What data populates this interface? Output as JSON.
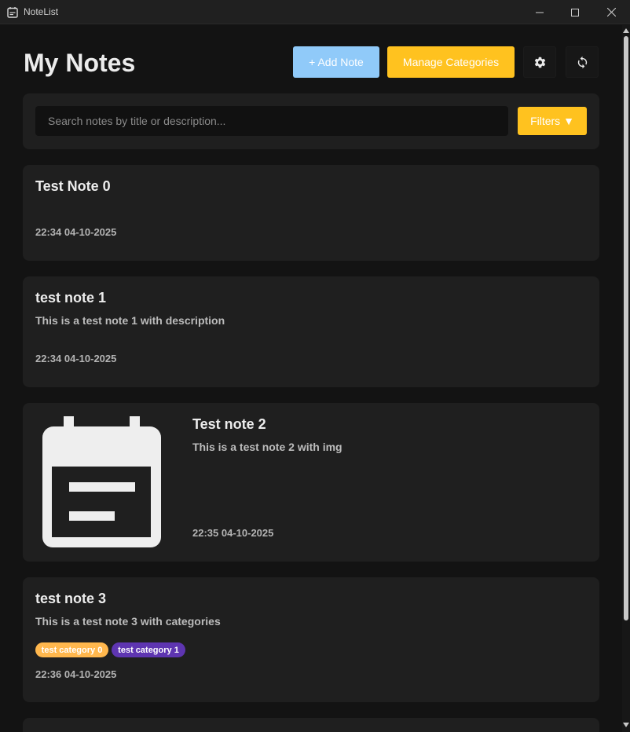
{
  "window": {
    "title": "NoteList"
  },
  "header": {
    "title": "My Notes",
    "add_note_label": "+ Add Note",
    "manage_categories_label": "Manage Categories",
    "settings_icon": "gear-icon",
    "refresh_icon": "refresh-icon"
  },
  "search": {
    "placeholder": "Search notes by title or description...",
    "filters_label": "Filters ▼"
  },
  "notes": [
    {
      "title": "Test Note 0",
      "description": "",
      "timestamp": "22:34 04-10-2025"
    },
    {
      "title": "test note 1",
      "description": "This is a test note 1 with description",
      "timestamp": "22:34 04-10-2025"
    },
    {
      "title": "Test note 2",
      "description": "This is a test note 2 with img",
      "timestamp": "22:35 04-10-2025",
      "image_icon": "calendar-note-icon"
    },
    {
      "title": "test note 3",
      "description": "This is a test note 3 with categories",
      "timestamp": "22:36 04-10-2025",
      "categories": [
        {
          "name": "test category 0",
          "color": "#ffb74d"
        },
        {
          "name": "test category 1",
          "color": "#5e35b1"
        }
      ]
    }
  ],
  "colors": {
    "accent_yellow": "#ffc21f",
    "accent_blue": "#90caf9",
    "card_bg": "#1f1f1f",
    "page_bg": "#131313"
  }
}
